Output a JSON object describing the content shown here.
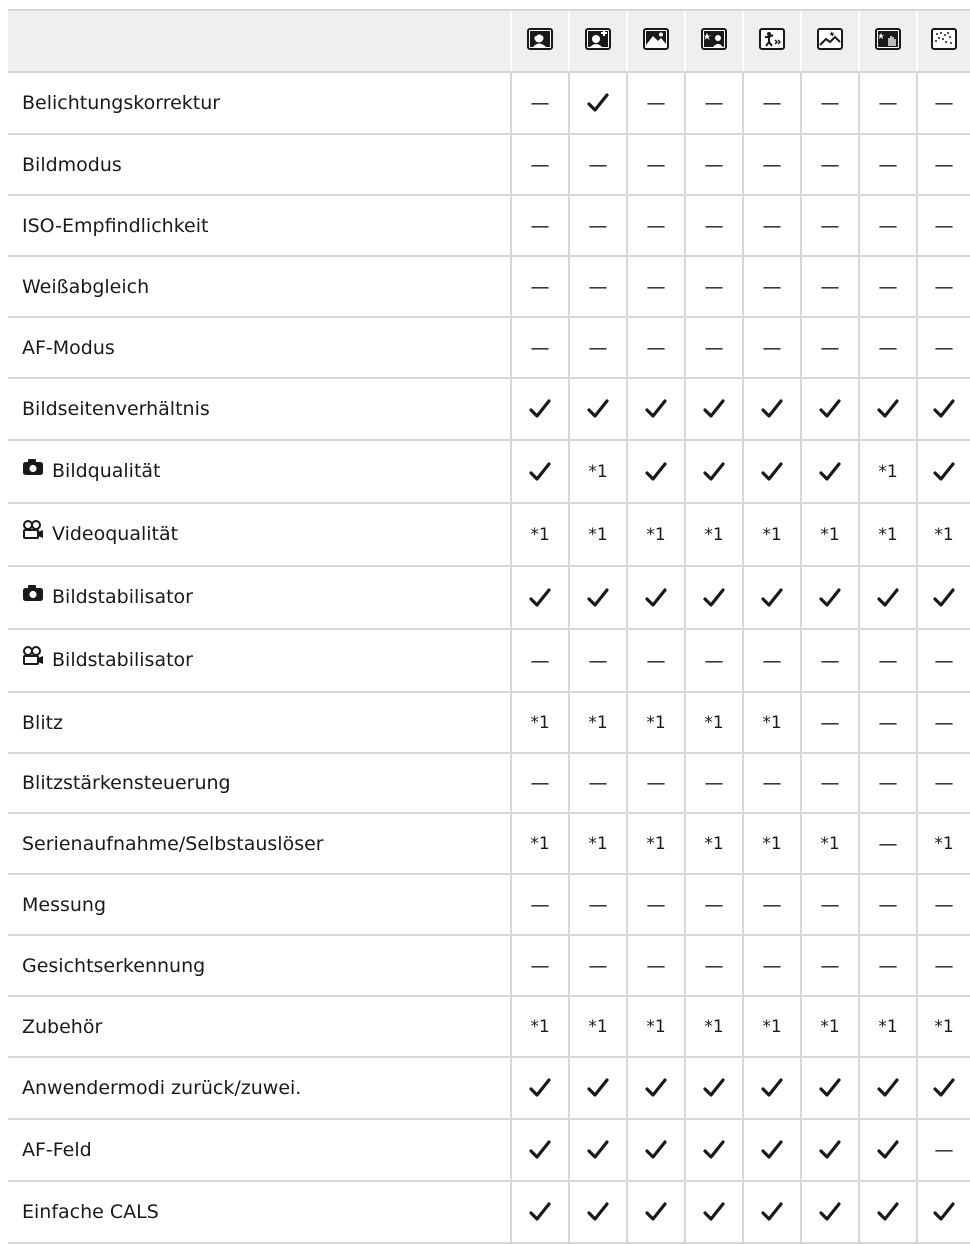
{
  "scene_icons": [
    "portrait-scene-icon",
    "e-portrait-scene-icon",
    "landscape-scene-icon",
    "night-portrait-scene-icon",
    "children-scene-icon",
    "night-scene-icon",
    "hand-held-starlight-scene-icon",
    "fireworks-scene-icon"
  ],
  "rows": [
    {
      "label": "Belichtungskorrektur",
      "icon": "",
      "values": [
        "—",
        "✓",
        "—",
        "—",
        "—",
        "—",
        "—",
        "—"
      ]
    },
    {
      "label": "Bildmodus",
      "icon": "",
      "values": [
        "—",
        "—",
        "—",
        "—",
        "—",
        "—",
        "—",
        "—"
      ]
    },
    {
      "label": "ISO-Empfindlichkeit",
      "icon": "",
      "values": [
        "—",
        "—",
        "—",
        "—",
        "—",
        "—",
        "—",
        "—"
      ]
    },
    {
      "label": "Weißabgleich",
      "icon": "",
      "values": [
        "—",
        "—",
        "—",
        "—",
        "—",
        "—",
        "—",
        "—"
      ]
    },
    {
      "label": "AF-Modus",
      "icon": "",
      "values": [
        "—",
        "—",
        "—",
        "—",
        "—",
        "—",
        "—",
        "—"
      ]
    },
    {
      "label": "Bildseitenverhältnis",
      "icon": "",
      "values": [
        "✓",
        "✓",
        "✓",
        "✓",
        "✓",
        "✓",
        "✓",
        "✓"
      ]
    },
    {
      "label": "Bildqualität",
      "icon": "camera-icon",
      "values": [
        "✓",
        "*1",
        "✓",
        "✓",
        "✓",
        "✓",
        "*1",
        "✓"
      ]
    },
    {
      "label": "Videoqualität",
      "icon": "movie-camera-icon",
      "values": [
        "*1",
        "*1",
        "*1",
        "*1",
        "*1",
        "*1",
        "*1",
        "*1"
      ]
    },
    {
      "label": "Bildstabilisator",
      "icon": "camera-icon",
      "values": [
        "✓",
        "✓",
        "✓",
        "✓",
        "✓",
        "✓",
        "✓",
        "✓"
      ]
    },
    {
      "label": "Bildstabilisator",
      "icon": "movie-camera-icon",
      "values": [
        "—",
        "—",
        "—",
        "—",
        "—",
        "—",
        "—",
        "—"
      ]
    },
    {
      "label": "Blitz",
      "icon": "",
      "values": [
        "*1",
        "*1",
        "*1",
        "*1",
        "*1",
        "—",
        "—",
        "—"
      ]
    },
    {
      "label": "Blitzstärkensteuerung",
      "icon": "",
      "values": [
        "—",
        "—",
        "—",
        "—",
        "—",
        "—",
        "—",
        "—"
      ]
    },
    {
      "label": "Serienaufnahme/Selbstauslöser",
      "icon": "",
      "values": [
        "*1",
        "*1",
        "*1",
        "*1",
        "*1",
        "*1",
        "—",
        "*1"
      ]
    },
    {
      "label": "Messung",
      "icon": "",
      "values": [
        "—",
        "—",
        "—",
        "—",
        "—",
        "—",
        "—",
        "—"
      ]
    },
    {
      "label": "Gesichtserkennung",
      "icon": "",
      "values": [
        "—",
        "—",
        "—",
        "—",
        "—",
        "—",
        "—",
        "—"
      ]
    },
    {
      "label": "Zubehör",
      "icon": "",
      "values": [
        "*1",
        "*1",
        "*1",
        "*1",
        "*1",
        "*1",
        "*1",
        "*1"
      ]
    },
    {
      "label": "Anwendermodi zurück/zuwei.",
      "icon": "",
      "values": [
        "✓",
        "✓",
        "✓",
        "✓",
        "✓",
        "✓",
        "✓",
        "✓"
      ]
    },
    {
      "label": "AF-Feld",
      "icon": "",
      "values": [
        "✓",
        "✓",
        "✓",
        "✓",
        "✓",
        "✓",
        "✓",
        "—"
      ]
    },
    {
      "label": "Einfache CALS",
      "icon": "",
      "values": [
        "✓",
        "✓",
        "✓",
        "✓",
        "✓",
        "✓",
        "✓",
        "✓"
      ]
    }
  ]
}
